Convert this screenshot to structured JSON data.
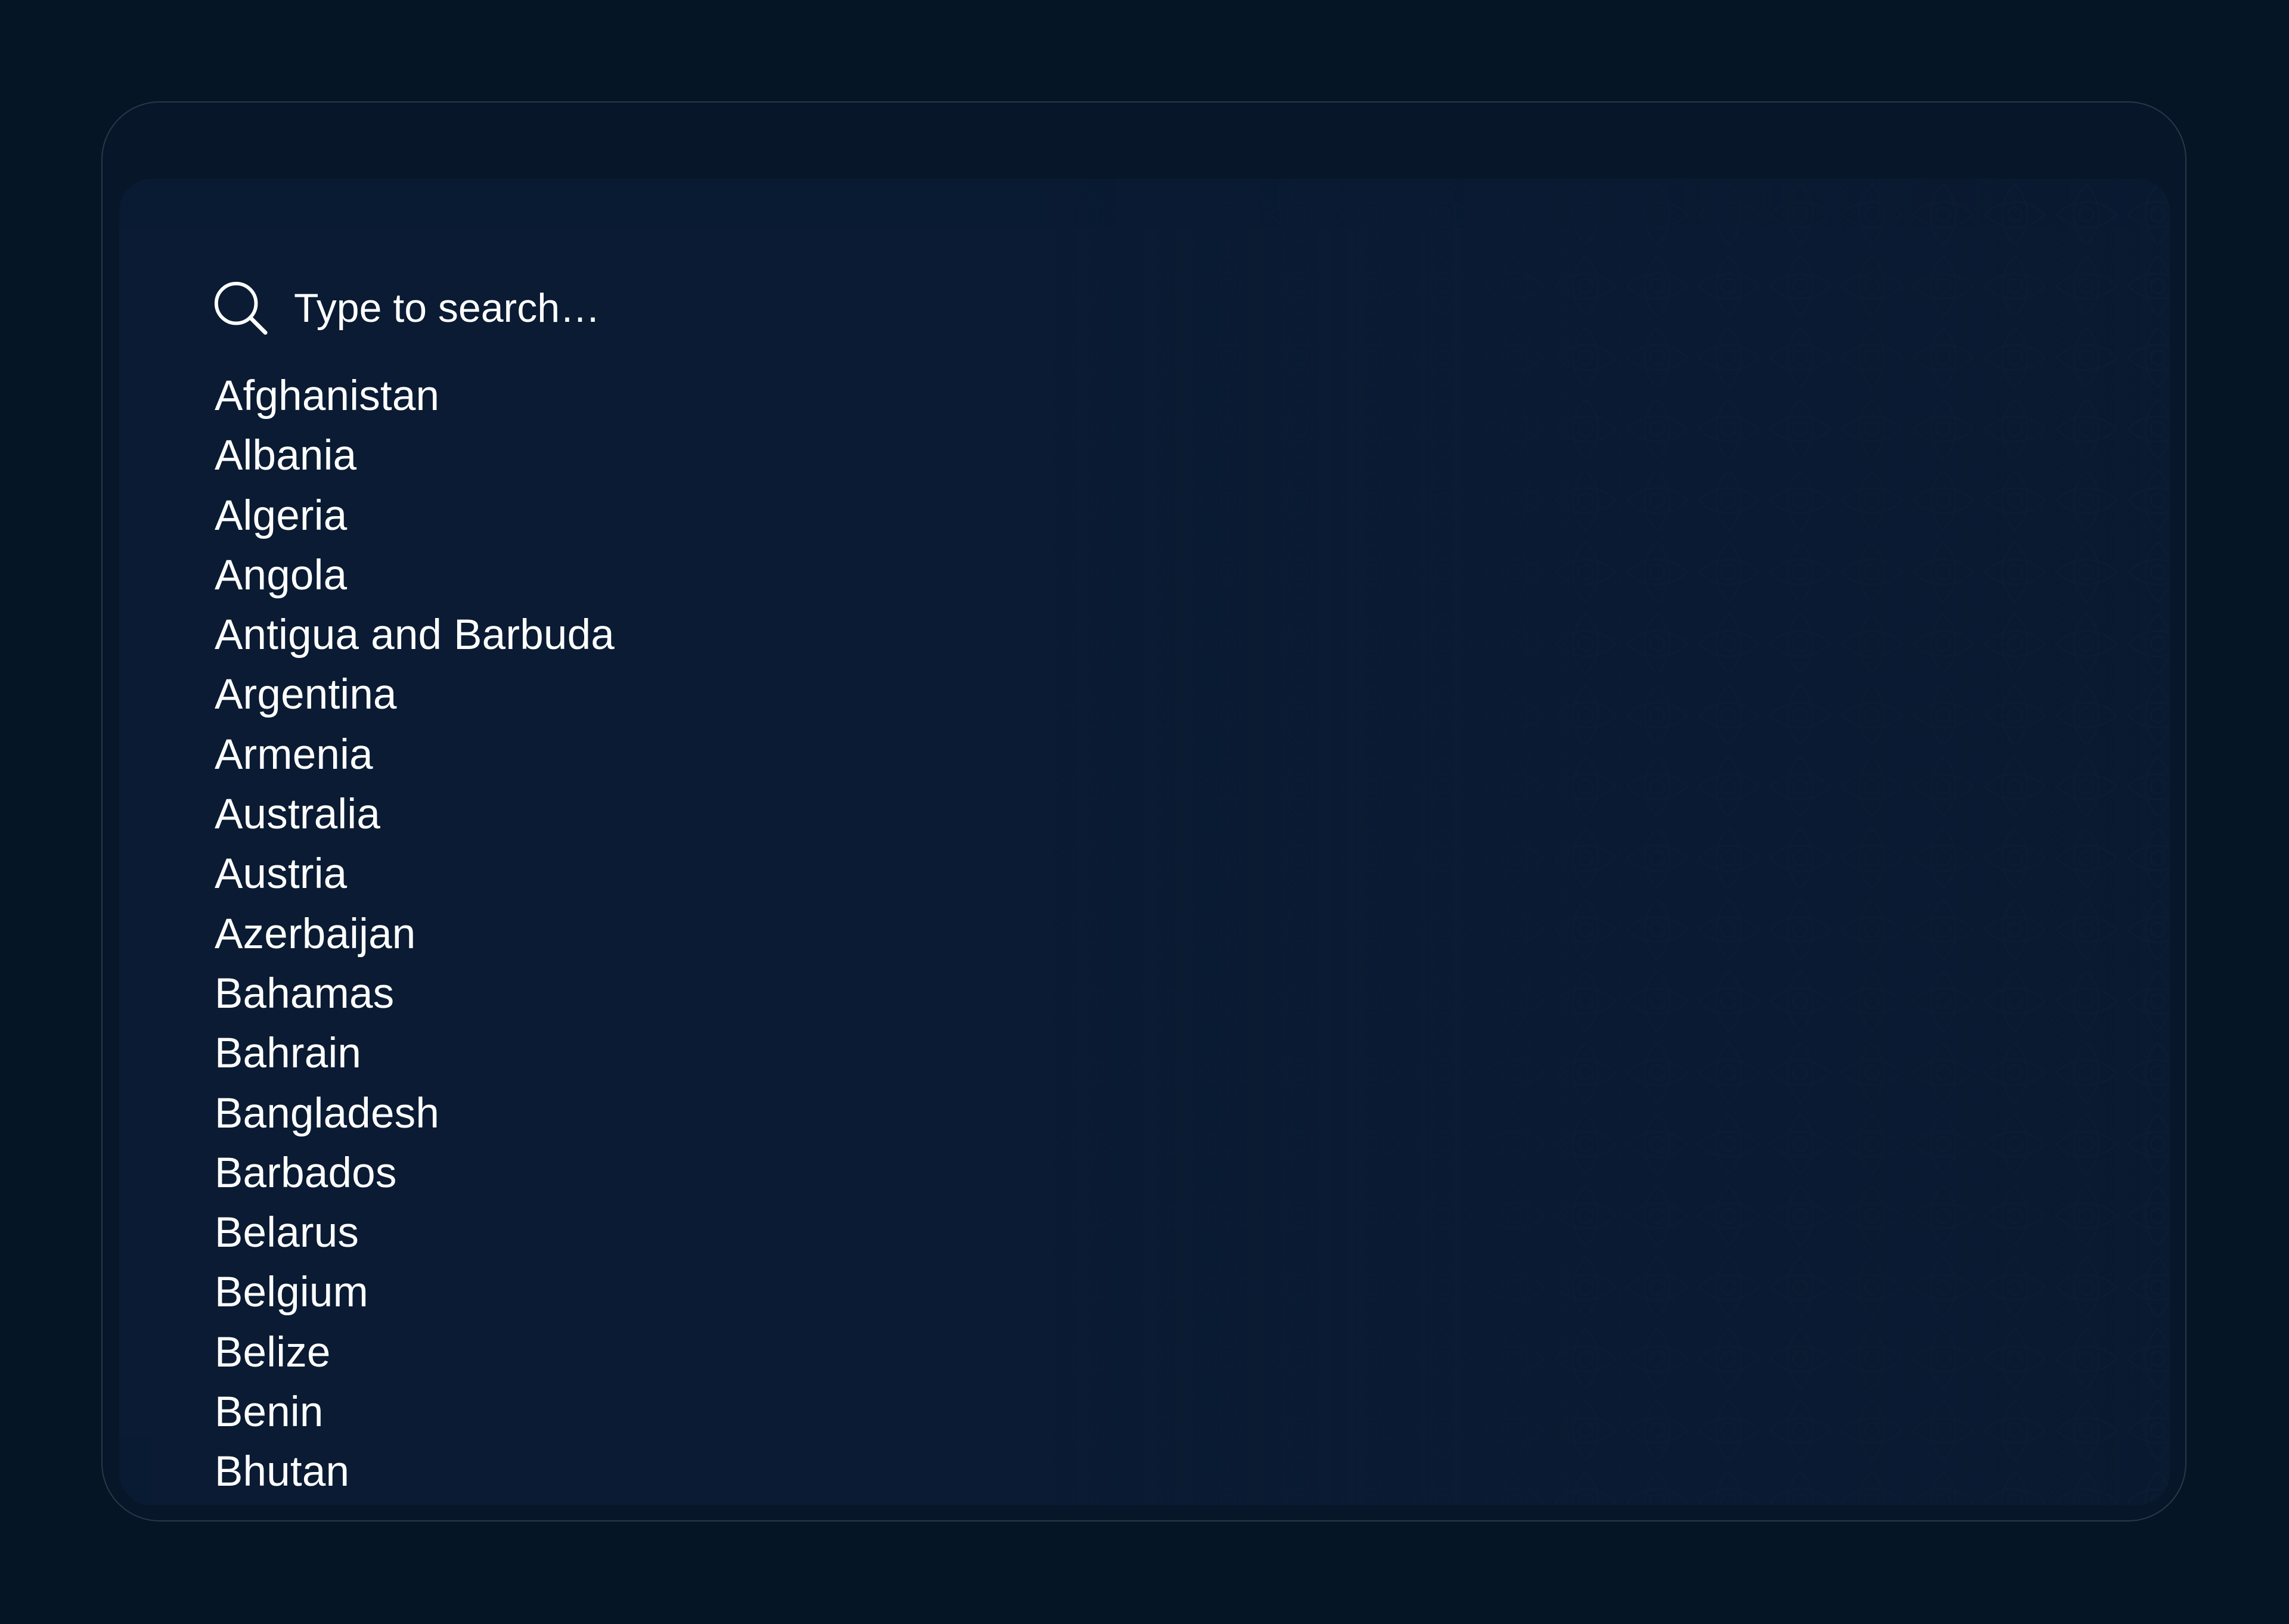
{
  "search": {
    "placeholder": "Type to search…",
    "value": ""
  },
  "countries": [
    "Afghanistan",
    "Albania",
    "Algeria",
    "Angola",
    "Antigua and Barbuda",
    "Argentina",
    "Armenia",
    "Australia",
    "Austria",
    "Azerbaijan",
    "Bahamas",
    "Bahrain",
    "Bangladesh",
    "Barbados",
    "Belarus",
    "Belgium",
    "Belize",
    "Benin",
    "Bhutan"
  ],
  "colors": {
    "page_background": "#061526",
    "frame_background": "#071628",
    "panel_background": "#0a1b33",
    "frame_border": "#26384a",
    "text": "#ffffff"
  },
  "icons": {
    "search": "search-icon"
  }
}
